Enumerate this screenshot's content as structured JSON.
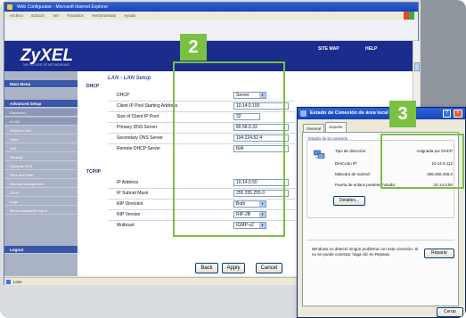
{
  "browser": {
    "title": "Web Configurator - Microsoft Internet Explorer",
    "menu": [
      "Archivo",
      "Edición",
      "Ver",
      "Favoritos",
      "Herramientas",
      "Ayuda"
    ],
    "status": "Listo"
  },
  "header": {
    "logo": "ZyXEL",
    "tagline": "THE FUTURE OF NETWORKING",
    "site_map": "SITE MAP",
    "help": "HELP"
  },
  "sidebar": {
    "items": [
      {
        "label": "Main Menu",
        "kind": "main"
      },
      {
        "label": "",
        "kind": "plain"
      },
      {
        "label": "Advanced Setup",
        "kind": "main"
      },
      {
        "label": "Password",
        "kind": "sub"
      },
      {
        "label": "LAN",
        "kind": "sub"
      },
      {
        "label": "Wireless LAN",
        "kind": "plain"
      },
      {
        "label": "WAN",
        "kind": "plain"
      },
      {
        "label": "NAT",
        "kind": "plain"
      },
      {
        "label": "Security",
        "kind": "plain"
      },
      {
        "label": "Dynamic DNS",
        "kind": "plain"
      },
      {
        "label": "Time and Date",
        "kind": "plain"
      },
      {
        "label": "Remote Management",
        "kind": "plain"
      },
      {
        "label": "UPnP",
        "kind": "plain"
      },
      {
        "label": "Logs",
        "kind": "plain"
      },
      {
        "label": "Media Bandwidth Mgmt",
        "kind": "plain"
      },
      {
        "label": "",
        "kind": "plain"
      },
      {
        "label": "Logout",
        "kind": "main"
      }
    ]
  },
  "form": {
    "title": "LAN - LAN Setup",
    "dhcp_section": "DHCP",
    "dhcp_fields": [
      {
        "label": "DHCP",
        "value": "Server",
        "type": "select"
      },
      {
        "label": "Client IP Pool Starting Address",
        "value": "10.14.0.100",
        "type": "text"
      },
      {
        "label": "Size of Client IP Pool",
        "value": "32",
        "type": "short"
      },
      {
        "label": "Primary DNS Server",
        "value": "80.58.0.33",
        "type": "text"
      },
      {
        "label": "Secondary DNS Server",
        "value": "194.224.52.4",
        "type": "text"
      },
      {
        "label": "Remote DHCP Server",
        "value": "N/A",
        "type": "text"
      }
    ],
    "tcpip_section": "TCP/IP",
    "tcpip_fields": [
      {
        "label": "IP Address",
        "value": "10.14.0.50",
        "type": "text"
      },
      {
        "label": "IP Subnet Mask",
        "value": "255.255.255.0",
        "type": "text"
      },
      {
        "label": "RIP Direction",
        "value": "Both",
        "type": "select"
      },
      {
        "label": "RIP Version",
        "value": "RIP-2B",
        "type": "select"
      },
      {
        "label": "Multicast",
        "value": "IGMP-v2",
        "type": "select"
      }
    ],
    "back": "Back",
    "apply": "Apply",
    "cancel": "Cancel"
  },
  "callouts": {
    "two": "2",
    "three": "3"
  },
  "dialog": {
    "title": "Estado de Conexión de área local",
    "tabs": [
      "General",
      "Soporte"
    ],
    "group_title": "Estado de la conexión",
    "rows": [
      {
        "key": "Tipo de dirección:",
        "value": "Asignada por DHCP"
      },
      {
        "key": "Dirección IP:",
        "value": "10.14.0.112"
      },
      {
        "key": "Máscara de subred:",
        "value": "255.255.255.0"
      },
      {
        "key": "Puerta de enlace predeterminada:",
        "value": "10.14.0.50"
      }
    ],
    "details_button": "Detalles...",
    "repair_text": "Windows no detectó ningún problema con esta conexión. Si no se puede conectar, haga clic en Reparar.",
    "repair_button": "Reparar",
    "close_button": "Cerrar"
  },
  "colors": {
    "highlight": "#7ac143",
    "zyxel_blue": "#1b2c8c"
  }
}
